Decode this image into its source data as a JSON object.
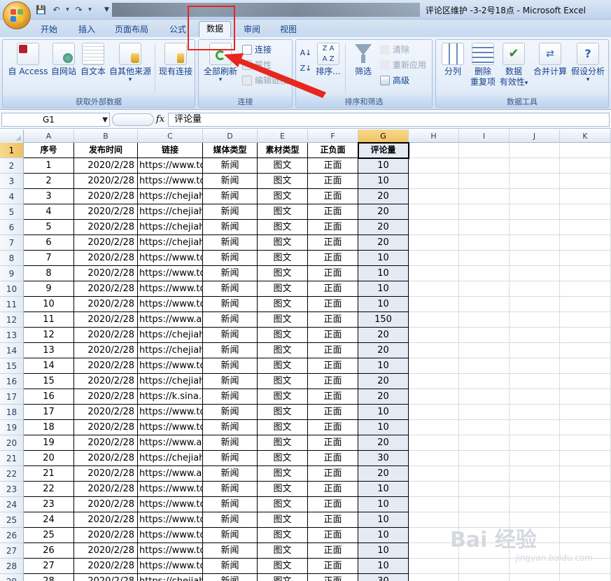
{
  "window": {
    "title": "评论区维护 -3-2号18点 - Microsoft Excel"
  },
  "quick_access": {
    "icons": [
      "save-icon",
      "undo-icon",
      "redo-icon",
      "customize-icon"
    ]
  },
  "tabs": [
    {
      "label": "开始"
    },
    {
      "label": "插入"
    },
    {
      "label": "页面布局"
    },
    {
      "label": "公式"
    },
    {
      "label": "数据",
      "active": true
    },
    {
      "label": "审阅"
    },
    {
      "label": "视图"
    }
  ],
  "ribbon": {
    "groups": {
      "external": {
        "caption": "获取外部数据",
        "buttons": [
          "自 Access",
          "自网站",
          "自文本",
          "自其他来源",
          "现有连接"
        ]
      },
      "connections": {
        "caption": "连接",
        "refresh_label": "全部刷新",
        "small": [
          "连接",
          "属性",
          "编辑链接"
        ]
      },
      "sort": {
        "caption": "排序和筛选",
        "sort_label": "排序...",
        "filter_label": "筛选",
        "small": [
          "清除",
          "重新应用",
          "高级"
        ]
      },
      "tools": {
        "caption": "数据工具",
        "split": "分列",
        "remove_dup": [
          "删除",
          "重复项"
        ],
        "validation": [
          "数据",
          "有效性"
        ],
        "consolidate": "合并计算",
        "whatif": "假设分析"
      }
    }
  },
  "formula_bar": {
    "name_box": "G1",
    "fx": "fx",
    "content": "评论量"
  },
  "columns": [
    "A",
    "B",
    "C",
    "D",
    "E",
    "F",
    "G",
    "H",
    "I",
    "J",
    "K"
  ],
  "selected_column": "G",
  "table": {
    "headers": [
      "序号",
      "发布时间",
      "链接",
      "媒体类型",
      "素材类型",
      "正负面",
      "评论量"
    ],
    "rows": [
      [
        "1",
        "2020/2/28",
        "https://www.to",
        "新闻",
        "图文",
        "正面",
        "10"
      ],
      [
        "2",
        "2020/2/28",
        "https://www.to",
        "新闻",
        "图文",
        "正面",
        "10"
      ],
      [
        "3",
        "2020/2/28",
        "https://chejiah",
        "新闻",
        "图文",
        "正面",
        "20"
      ],
      [
        "4",
        "2020/2/28",
        "https://chejiah",
        "新闻",
        "图文",
        "正面",
        "20"
      ],
      [
        "5",
        "2020/2/28",
        "https://chejiah",
        "新闻",
        "图文",
        "正面",
        "20"
      ],
      [
        "6",
        "2020/2/28",
        "https://chejiah",
        "新闻",
        "图文",
        "正面",
        "20"
      ],
      [
        "7",
        "2020/2/28",
        "https://www.to",
        "新闻",
        "图文",
        "正面",
        "10"
      ],
      [
        "8",
        "2020/2/28",
        "https://www.to",
        "新闻",
        "图文",
        "正面",
        "10"
      ],
      [
        "9",
        "2020/2/28",
        "https://www.to",
        "新闻",
        "图文",
        "正面",
        "10"
      ],
      [
        "10",
        "2020/2/28",
        "https://www.to",
        "新闻",
        "图文",
        "正面",
        "10"
      ],
      [
        "11",
        "2020/2/28",
        "https://www.au",
        "新闻",
        "图文",
        "正面",
        "150"
      ],
      [
        "12",
        "2020/2/28",
        "https://chejiah",
        "新闻",
        "图文",
        "正面",
        "20"
      ],
      [
        "13",
        "2020/2/28",
        "https://chejiah",
        "新闻",
        "图文",
        "正面",
        "20"
      ],
      [
        "14",
        "2020/2/28",
        "https://www.to",
        "新闻",
        "图文",
        "正面",
        "10"
      ],
      [
        "15",
        "2020/2/28",
        "https://chejiah",
        "新闻",
        "图文",
        "正面",
        "20"
      ],
      [
        "16",
        "2020/2/28",
        "https://k.sina.c",
        "新闻",
        "图文",
        "正面",
        "20"
      ],
      [
        "17",
        "2020/2/28",
        "https://www.to",
        "新闻",
        "图文",
        "正面",
        "10"
      ],
      [
        "18",
        "2020/2/28",
        "https://www.to",
        "新闻",
        "图文",
        "正面",
        "10"
      ],
      [
        "19",
        "2020/2/28",
        "https://www.au",
        "新闻",
        "图文",
        "正面",
        "20"
      ],
      [
        "20",
        "2020/2/28",
        "https://chejiah",
        "新闻",
        "图文",
        "正面",
        "30"
      ],
      [
        "21",
        "2020/2/28",
        "https://www.au",
        "新闻",
        "图文",
        "正面",
        "20"
      ],
      [
        "22",
        "2020/2/28",
        "https://www.to",
        "新闻",
        "图文",
        "正面",
        "10"
      ],
      [
        "23",
        "2020/2/28",
        "https://www.to",
        "新闻",
        "图文",
        "正面",
        "10"
      ],
      [
        "24",
        "2020/2/28",
        "https://www.to",
        "新闻",
        "图文",
        "正面",
        "10"
      ],
      [
        "25",
        "2020/2/28",
        "https://www.to",
        "新闻",
        "图文",
        "正面",
        "10"
      ],
      [
        "26",
        "2020/2/28",
        "https://www.to",
        "新闻",
        "图文",
        "正面",
        "10"
      ],
      [
        "27",
        "2020/2/28",
        "https://www.to",
        "新闻",
        "图文",
        "正面",
        "10"
      ],
      [
        "28",
        "2020/2/28",
        "https://chejiah",
        "新闻",
        "图文",
        "正面",
        "30"
      ]
    ]
  },
  "watermark": {
    "brand": "Bai 经验",
    "url": "jingyan.baidu.com"
  },
  "colors": {
    "annotation": "#e8261d",
    "selected_header": "#f1c15f",
    "ribbon": "#dde9f7"
  }
}
